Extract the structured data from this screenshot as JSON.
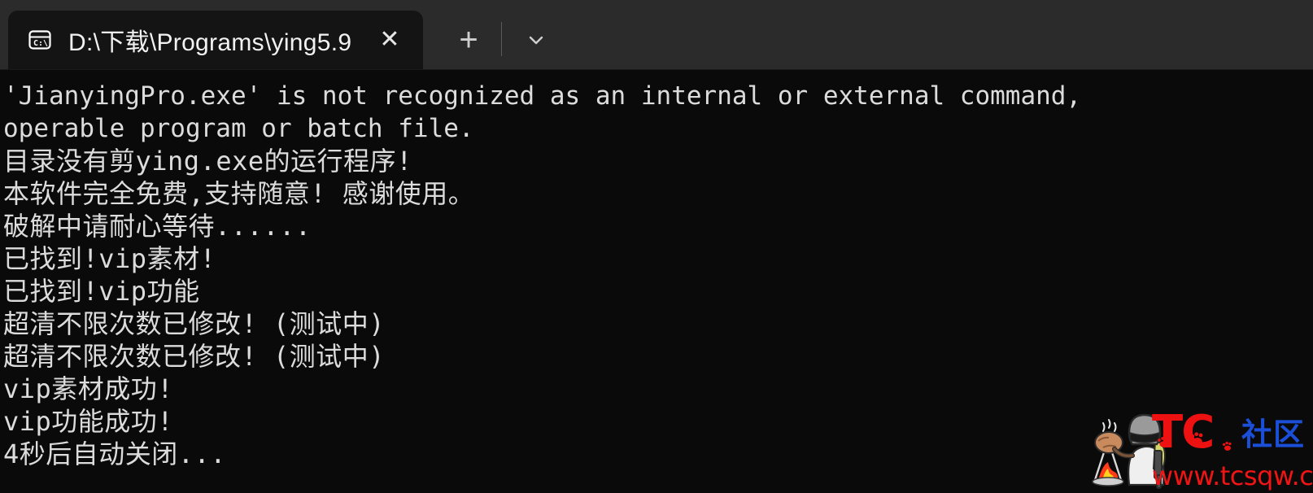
{
  "window": {
    "title": "D:\\下载\\Programs\\ying5.9",
    "background_color": "#0a0a0a",
    "tabstrip_color": "#2b2b2b",
    "text_color": "#dcdcdc"
  },
  "tabstrip": {
    "tabs": [
      {
        "icon": "command-prompt-icon",
        "icon_label": "C:\\",
        "title": "D:\\下载\\Programs\\ying5.9",
        "close_label": "✕",
        "active": true
      }
    ],
    "new_tab_label": "+",
    "new_tab_name": "new-tab-button",
    "dropdown_label": "⌄",
    "dropdown_name": "tab-dropdown-button"
  },
  "terminal": {
    "lines": [
      "'JianyingPro.exe' is not recognized as an internal or external command,",
      "operable program or batch file.",
      "目录没有剪ying.exe的运行程序!",
      "本软件完全免费,支持随意! 感谢使用。",
      "破解中请耐心等待......",
      "已找到!vip素材!",
      "已找到!vip功能",
      "超清不限次数已修改! (测试中)",
      "超清不限次数已修改! (测试中)",
      "vip素材成功!",
      "vip功能成功!",
      "4秒后自动关闭..."
    ]
  },
  "watermark": {
    "brand": "TC",
    "brand_suffix": "社区",
    "url": "www.tcsqw.com",
    "brand_color": "#ee1111",
    "suffix_color": "#1b4fd8",
    "url_color": "#f01414",
    "mascot": "pubg-character-cooking-icon"
  }
}
